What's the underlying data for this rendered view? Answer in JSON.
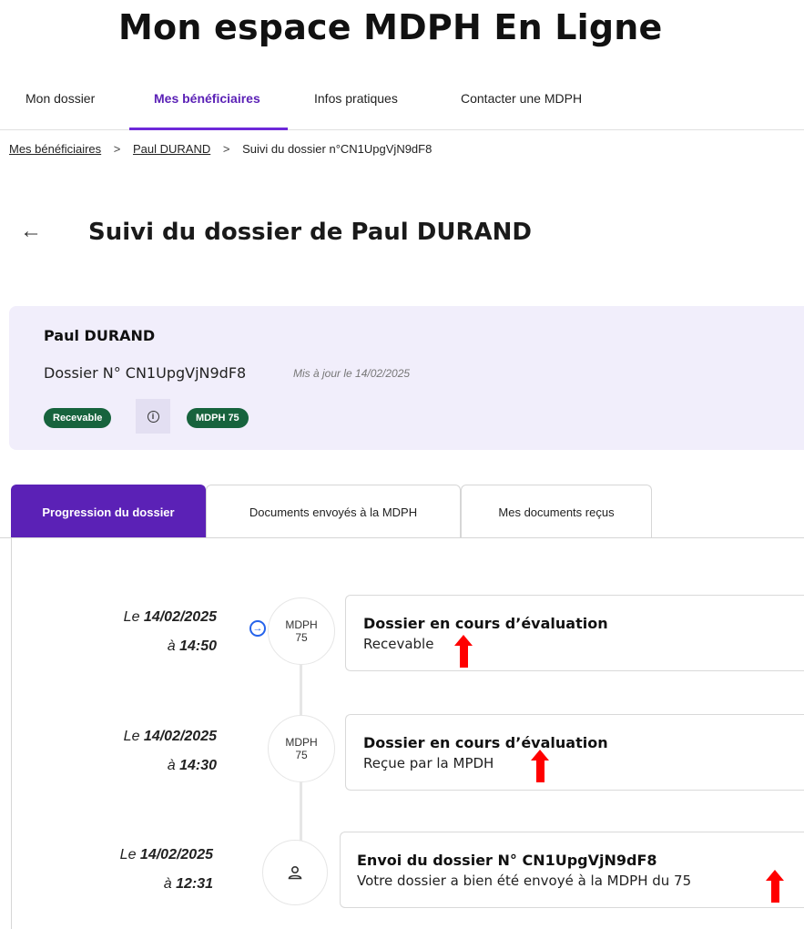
{
  "app": {
    "title": "Mon espace MDPH En Ligne"
  },
  "nav": {
    "items": [
      {
        "label": "Mon dossier"
      },
      {
        "label": "Mes bénéficiaires",
        "active": true
      },
      {
        "label": "Infos pratiques"
      },
      {
        "label": "Contacter une MDPH"
      }
    ]
  },
  "breadcrumb": {
    "items": [
      "Mes bénéficiaires",
      "Paul DURAND",
      "Suivi du dossier n°CN1UpgVjN9dF8"
    ],
    "separator": ">"
  },
  "page": {
    "title": "Suivi du dossier de Paul DURAND",
    "back_icon": "arrow-left-icon"
  },
  "summary": {
    "name": "Paul DURAND",
    "dossier": "Dossier N° CN1UpgVjN9dF8",
    "updated": "Mis à jour le 14/02/2025",
    "badges": [
      "Recevable",
      "MDPH 75"
    ],
    "info_icon": "info-icon",
    "badge_color": "#17633d"
  },
  "tabs": [
    {
      "label": "Progression du dossier",
      "active": true
    },
    {
      "label": "Documents envoyés à la MDPH"
    },
    {
      "label": "Mes documents reçus"
    }
  ],
  "timeline": [
    {
      "date_prefix": "Le",
      "date": "14/02/2025",
      "time_prefix": "à",
      "time": "14:50",
      "node_line1": "MDPH",
      "node_line2": "75",
      "title": "Dossier en cours d’évaluation",
      "subtitle": "Recevable"
    },
    {
      "date_prefix": "Le",
      "date": "14/02/2025",
      "time_prefix": "à",
      "time": "14:30",
      "node_line1": "MDPH",
      "node_line2": "75",
      "title": "Dossier en cours d’évaluation",
      "subtitle": "Reçue par la MPDH"
    },
    {
      "date_prefix": "Le",
      "date": "14/02/2025",
      "time_prefix": "à",
      "time": "12:31",
      "node_icon": "user-icon",
      "title": "Envoi du dossier N° CN1UpgVjN9dF8",
      "subtitle": "Votre dossier a bien été envoyé à la MDPH du 75"
    }
  ],
  "colors": {
    "accent": "#5b21b6",
    "summary_bg": "#f1eefb",
    "link_icon": "#2563eb",
    "annotation": "#ff0000"
  }
}
